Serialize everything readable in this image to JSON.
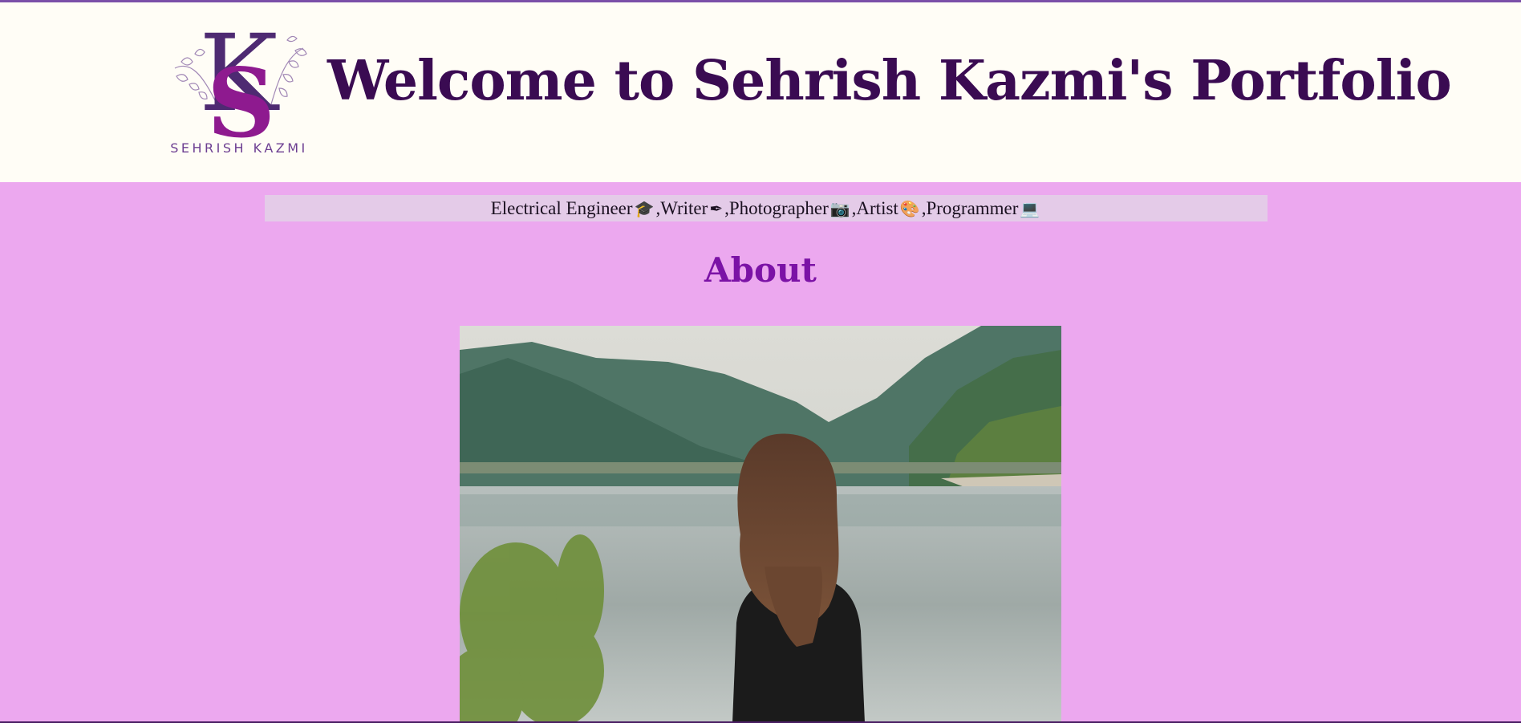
{
  "header": {
    "logo": {
      "monogram": "KS",
      "name": "SEHRISH KAZMI"
    },
    "title": "Welcome to Sehrish Kazmi's Portfolio"
  },
  "tagline": {
    "items": [
      {
        "text": "Electrical Engineer",
        "icon": "graduation-cap-icon",
        "glyph": "🎓",
        "sep": ", "
      },
      {
        "text": "Writer",
        "icon": "pen-icon",
        "glyph": "✒",
        "sep": ", "
      },
      {
        "text": "Photographer ",
        "icon": "camera-icon",
        "glyph": "📷",
        "sep": ", "
      },
      {
        "text": "Artist ",
        "icon": "palette-icon",
        "glyph": "🎨",
        "sep": ", "
      },
      {
        "text": "Programmer ",
        "icon": "laptop-icon",
        "glyph": "💻",
        "sep": ""
      }
    ]
  },
  "about": {
    "heading": "About"
  },
  "colors": {
    "page_bg": "#eca8ef",
    "header_bg": "#fffdf6",
    "title": "#3a0b52",
    "about_heading": "#7b12a6",
    "tagline_bg": "#e4cbe8"
  }
}
